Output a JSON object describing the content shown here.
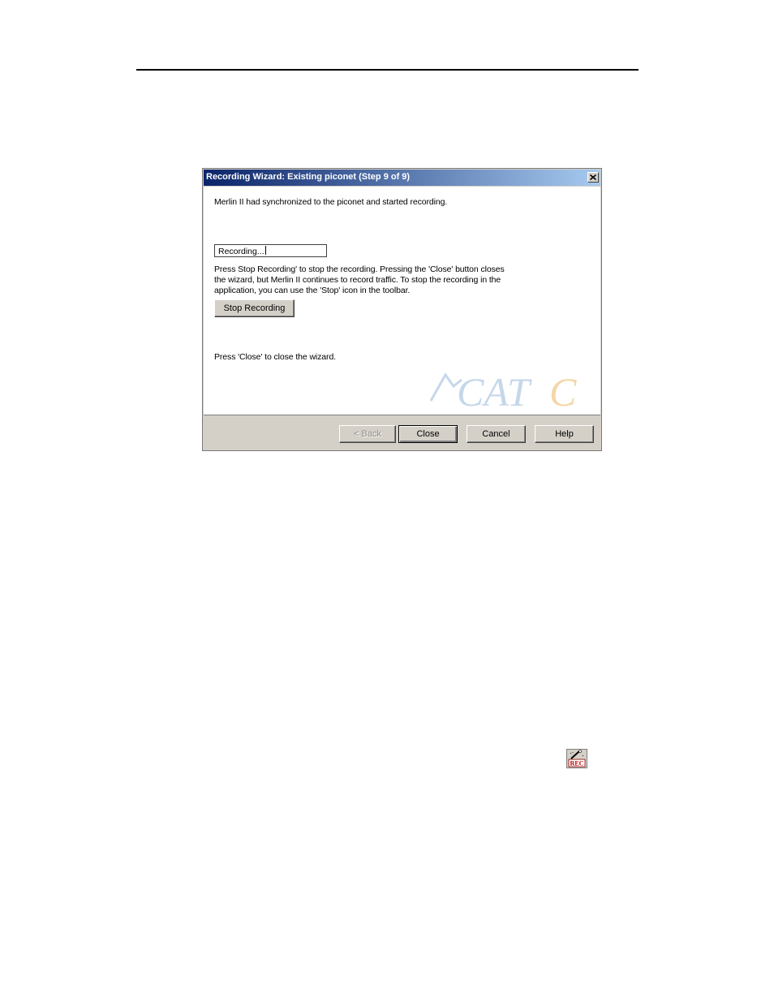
{
  "dialog": {
    "title": "Recording Wizard: Existing piconet (Step 9 of 9)",
    "close_icon": "close-icon",
    "sync_message": "Merlin II   had synchronized to the piconet and started recording.",
    "status_field_value": "Recording...",
    "description_lines": [
      "Press Stop Recording' to stop the recording. Pressing the 'Close' button closes",
      "the wizard, but Merlin II   continues to record traffic. To stop the recording in the",
      "application, you can use the 'Stop' icon in the toolbar."
    ],
    "stop_recording_label": "Stop Recording",
    "close_hint": "Press 'Close' to close the wizard.",
    "logo_text": "CATC",
    "buttons": {
      "back": "< Back",
      "close": "Close",
      "cancel": "Cancel",
      "help": "Help"
    }
  },
  "toolbar_icon": {
    "name": "record-wizard-icon",
    "label": "REC"
  },
  "colors": {
    "titlebar_start": "#0a246a",
    "titlebar_end": "#a6caf0",
    "dialog_face": "#d4d0c8",
    "logo": "#c6d7ea",
    "logo_accent": "#f5d6a8"
  }
}
